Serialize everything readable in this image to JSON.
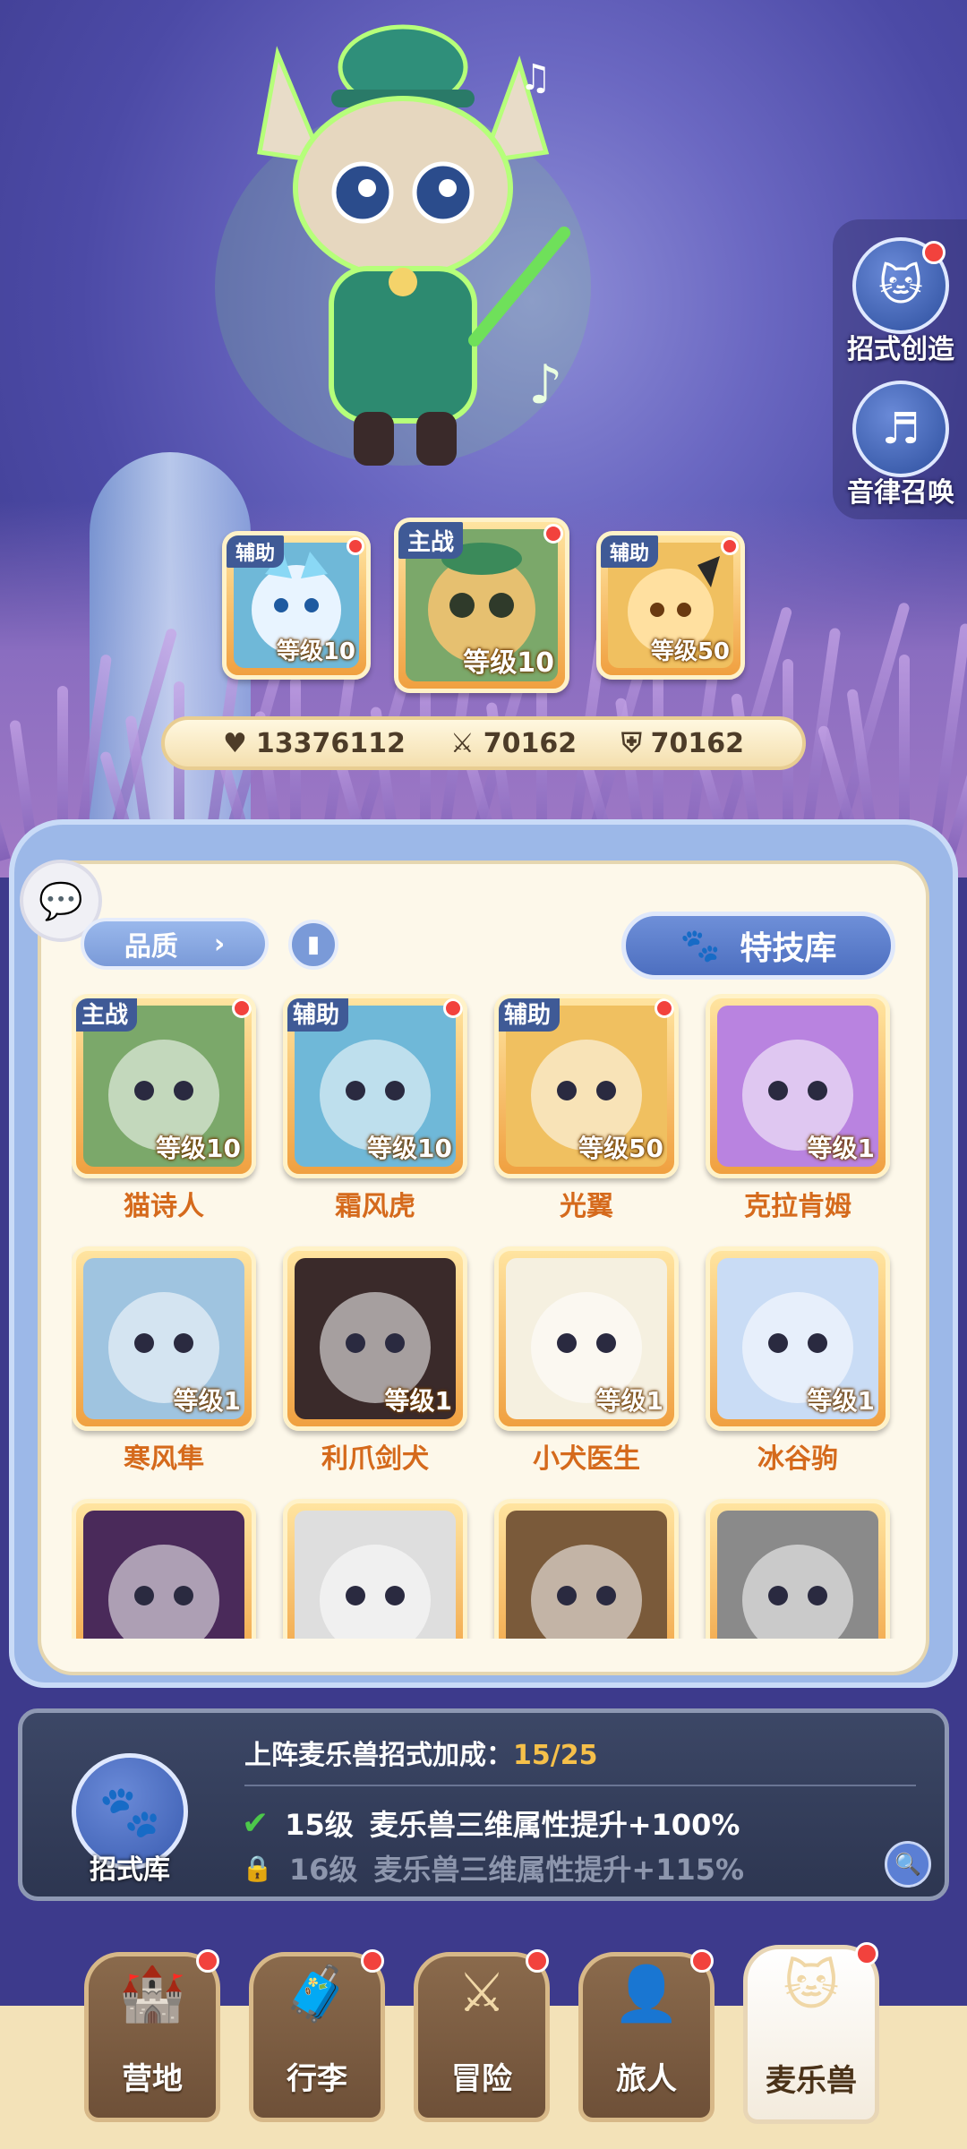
{
  "side_buttons": [
    {
      "label": "招式创造",
      "icon": "scroll-cat-icon"
    },
    {
      "label": "音律召唤",
      "icon": "lyre-icon"
    }
  ],
  "team": [
    {
      "role": "辅助",
      "level": "等级10"
    },
    {
      "role": "主战",
      "level": "等级10"
    },
    {
      "role": "辅助",
      "level": "等级50"
    }
  ],
  "stats": {
    "hp": "13376112",
    "atk": "70162",
    "def": "70162"
  },
  "filters": {
    "quality_label": "品质",
    "skill_library_label": "特技库"
  },
  "pets": [
    {
      "name": "猫诗人",
      "tag": "主战",
      "level": "等级10",
      "color": "#7ba86a"
    },
    {
      "name": "霜风虎",
      "tag": "辅助",
      "level": "等级10",
      "color": "#6fb8d8"
    },
    {
      "name": "光翼",
      "tag": "辅助",
      "level": "等级50",
      "color": "#f0c060"
    },
    {
      "name": "克拉肯姆",
      "tag": "",
      "level": "等级1",
      "color": "#b983e0"
    },
    {
      "name": "寒风隼",
      "tag": "",
      "level": "等级1",
      "color": "#9fc4e0"
    },
    {
      "name": "利爪剑犬",
      "tag": "",
      "level": "等级1",
      "color": "#3a2a2a"
    },
    {
      "name": "小犬医生",
      "tag": "",
      "level": "等级1",
      "color": "#f5f0e0"
    },
    {
      "name": "冰谷驹",
      "tag": "",
      "level": "等级1",
      "color": "#c9dcf5"
    },
    {
      "name": "",
      "tag": "",
      "level": "",
      "color": "#4a2a5a"
    },
    {
      "name": "",
      "tag": "",
      "level": "",
      "color": "#dedede"
    },
    {
      "name": "",
      "tag": "",
      "level": "",
      "color": "#7a5a3a"
    },
    {
      "name": "",
      "tag": "",
      "level": "",
      "color": "#8a8a8a"
    }
  ],
  "bonus": {
    "title": "上阵麦乐兽招式加成：",
    "value": "15/25",
    "icon_label": "招式库",
    "rows": [
      {
        "level": "15级",
        "text": "麦乐兽三维属性提升+100%",
        "status": "unlocked"
      },
      {
        "level": "16级",
        "text": "麦乐兽三维属性提升+115%",
        "status": "locked"
      }
    ]
  },
  "nav": [
    {
      "label": "营地",
      "icon": "castle-icon",
      "active": false
    },
    {
      "label": "行李",
      "icon": "luggage-icon",
      "active": false
    },
    {
      "label": "冒险",
      "icon": "crossed-swords-icon",
      "active": false
    },
    {
      "label": "旅人",
      "icon": "traveler-icon",
      "active": false
    },
    {
      "label": "麦乐兽",
      "icon": "cat-face-icon",
      "active": true
    }
  ]
}
